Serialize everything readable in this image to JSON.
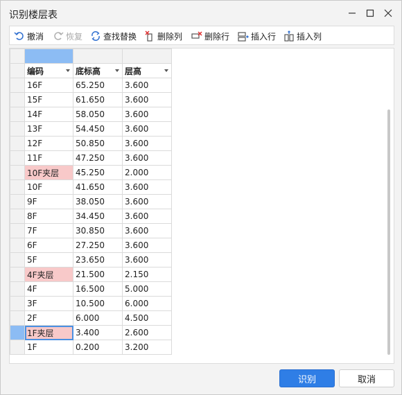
{
  "window": {
    "title": "识别楼层表"
  },
  "toolbar": {
    "undo": "撤消",
    "redo": "恢复",
    "find_replace": "查找替换",
    "delete_column": "删除列",
    "delete_row": "删除行",
    "insert_row": "插入行",
    "insert_column": "插入列"
  },
  "table": {
    "headers": [
      "编码",
      "底标高",
      "层高"
    ],
    "rows": [
      [
        "16F",
        "65.250",
        "3.600"
      ],
      [
        "15F",
        "61.650",
        "3.600"
      ],
      [
        "14F",
        "58.050",
        "3.600"
      ],
      [
        "13F",
        "54.450",
        "3.600"
      ],
      [
        "12F",
        "50.850",
        "3.600"
      ],
      [
        "11F",
        "47.250",
        "3.600"
      ],
      [
        "10F夹层",
        "45.250",
        "2.000"
      ],
      [
        "10F",
        "41.650",
        "3.600"
      ],
      [
        "9F",
        "38.050",
        "3.600"
      ],
      [
        "8F",
        "34.450",
        "3.600"
      ],
      [
        "7F",
        "30.850",
        "3.600"
      ],
      [
        "6F",
        "27.250",
        "3.600"
      ],
      [
        "5F",
        "23.650",
        "3.600"
      ],
      [
        "4F夹层",
        "21.500",
        "2.150"
      ],
      [
        "4F",
        "16.500",
        "5.000"
      ],
      [
        "3F",
        "10.500",
        "6.000"
      ],
      [
        "2F",
        "6.000",
        "4.500"
      ],
      [
        "1F夹层",
        "3.400",
        "2.600"
      ],
      [
        "1F",
        "0.200",
        "3.200"
      ]
    ]
  },
  "buttons": {
    "ok": "识别",
    "cancel": "取消"
  },
  "colors": {
    "highlight": "#f8c9c9",
    "selection": "#8cbcf4",
    "primary": "#2f7ee6"
  }
}
